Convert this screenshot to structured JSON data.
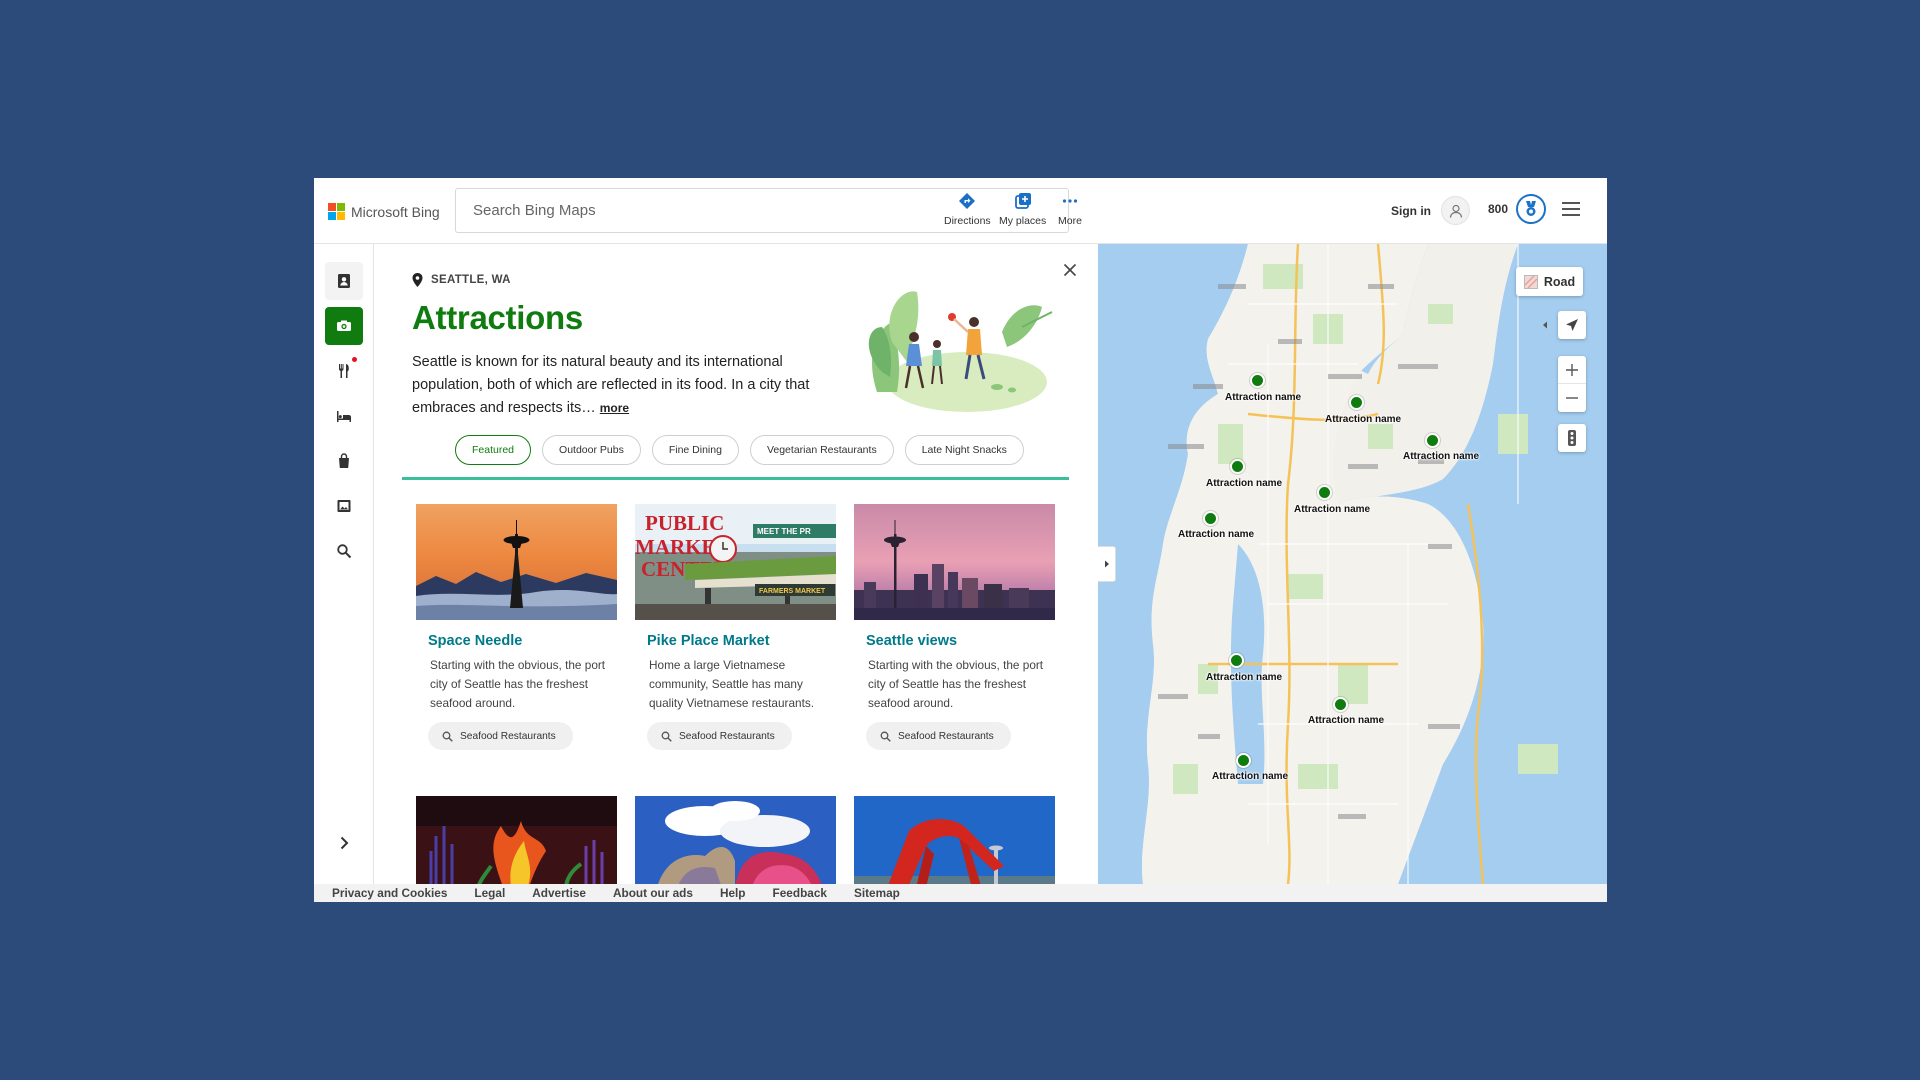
{
  "header": {
    "brand": "Microsoft Bing",
    "search_placeholder": "Search Bing Maps",
    "buttons": [
      {
        "label": "Directions",
        "icon": "directions-icon"
      },
      {
        "label": "My places",
        "icon": "my-places-icon"
      },
      {
        "label": "More",
        "icon": "more-icon"
      }
    ],
    "signin_label": "Sign in",
    "rewards_points": "800"
  },
  "rail": {
    "items": [
      {
        "icon": "contacts-icon"
      },
      {
        "icon": "attractions-icon",
        "active": true
      },
      {
        "icon": "restaurant-icon",
        "badge": true
      },
      {
        "icon": "hotel-icon"
      },
      {
        "icon": "shopping-icon"
      },
      {
        "icon": "photos-icon"
      },
      {
        "icon": "search-icon"
      }
    ]
  },
  "panel": {
    "location": "SEATTLE, WA",
    "title": "Attractions",
    "description": "Seattle is known for its  natural beauty and its international population, both of which are reflected in its food. In a city that embraces and respects its…",
    "more_label": "more",
    "filters": [
      "Featured",
      "Outdoor Pubs",
      "Fine Dining",
      "Vegetarian Restaurants",
      "Late Night Snacks"
    ],
    "active_filter": "Featured",
    "cards": [
      {
        "title": "Space Needle",
        "text": "Starting with the obvious, the port city of Seattle has the freshest seafood around.",
        "button": "Seafood Restaurants"
      },
      {
        "title": "Pike Place Market",
        "text": "Home a large Vietnamese community, Seattle has many quality Vietnamese restaurants.",
        "button": "Seafood Restaurants"
      },
      {
        "title": "Seattle views",
        "text": "Starting with the obvious, the port city of Seattle has the freshest seafood around.",
        "button": "Seafood Restaurants"
      }
    ],
    "pike_sign": [
      "PUBLIC",
      "MARKET",
      "CENTER"
    ],
    "meet_sign": "MEET THE PR",
    "farmers_sign": "FARMERS MARKET"
  },
  "map": {
    "style_label": "Road",
    "pin_label": "Attraction name",
    "pin_count": 10
  },
  "footer": {
    "links": [
      "Privacy and Cookies",
      "Legal",
      "Advertise",
      "About our ads",
      "Help",
      "Feedback",
      "Sitemap"
    ]
  },
  "colors": {
    "background": "#2c4b7b",
    "accent_green": "#107c10",
    "card_title": "#007a8a",
    "tab_underline": "#3bbf9a"
  }
}
